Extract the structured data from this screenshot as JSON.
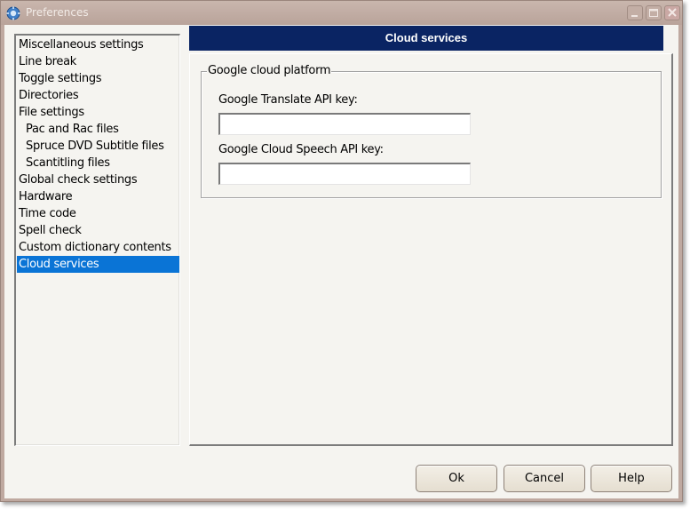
{
  "window": {
    "title": "Preferences",
    "icon": "gear-globe-icon",
    "controls": {
      "minimize": "minimize-icon",
      "maximize": "maximize-icon",
      "close": "close-icon"
    }
  },
  "sidebar": {
    "items": [
      {
        "label": "Miscellaneous settings",
        "indent": false,
        "selected": false
      },
      {
        "label": "Line break",
        "indent": false,
        "selected": false
      },
      {
        "label": "Toggle settings",
        "indent": false,
        "selected": false
      },
      {
        "label": "Directories",
        "indent": false,
        "selected": false
      },
      {
        "label": "File settings",
        "indent": false,
        "selected": false
      },
      {
        "label": "Pac and Rac files",
        "indent": true,
        "selected": false
      },
      {
        "label": "Spruce DVD Subtitle files",
        "indent": true,
        "selected": false
      },
      {
        "label": "Scantitling files",
        "indent": true,
        "selected": false
      },
      {
        "label": "Global check settings",
        "indent": false,
        "selected": false
      },
      {
        "label": "Hardware",
        "indent": false,
        "selected": false
      },
      {
        "label": "Time code",
        "indent": false,
        "selected": false
      },
      {
        "label": "Spell check",
        "indent": false,
        "selected": false
      },
      {
        "label": "Custom dictionary contents",
        "indent": false,
        "selected": false
      },
      {
        "label": "Cloud services",
        "indent": false,
        "selected": true
      }
    ],
    "selected_color": "#0a74d6"
  },
  "main": {
    "header": "Cloud services",
    "header_color": "#0a2463",
    "group": {
      "title": "Google cloud platform",
      "fields": [
        {
          "label": "Google Translate API key:",
          "value": "",
          "placeholder": ""
        },
        {
          "label": "Google Cloud Speech API key:",
          "value": "",
          "placeholder": ""
        }
      ]
    }
  },
  "buttons": {
    "ok": "Ok",
    "cancel": "Cancel",
    "help": "Help"
  }
}
